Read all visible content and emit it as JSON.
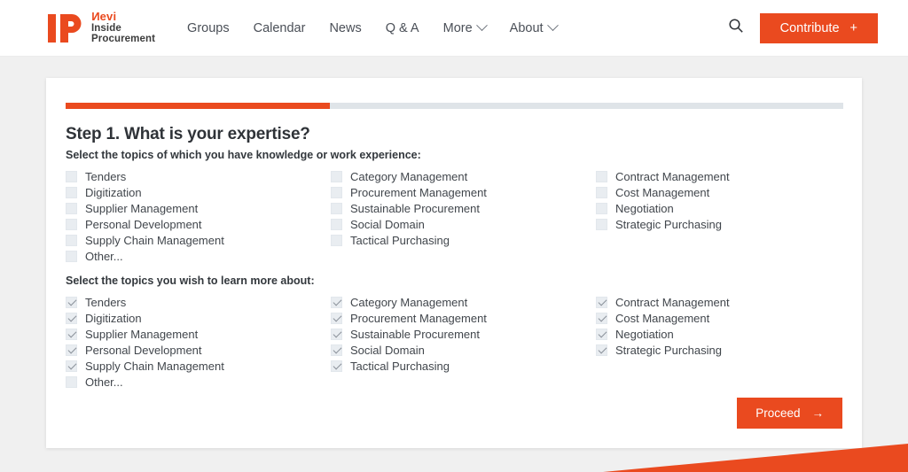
{
  "header": {
    "logo": {
      "mark_text": "IP",
      "brand": "Nevi",
      "line1": "Inside",
      "line2": "Procurement"
    },
    "nav": [
      {
        "label": "Groups",
        "has_chevron": false
      },
      {
        "label": "Calendar",
        "has_chevron": false
      },
      {
        "label": "News",
        "has_chevron": false
      },
      {
        "label": "Q & A",
        "has_chevron": false
      },
      {
        "label": "More",
        "has_chevron": true
      },
      {
        "label": "About",
        "has_chevron": true
      }
    ],
    "search_icon": "search-icon",
    "contribute_label": "Contribute",
    "contribute_plus": "+"
  },
  "card": {
    "progress": {
      "percent": 34,
      "value_label": "34%"
    },
    "step_title": "Step 1. What is your expertise?",
    "sections": [
      {
        "label": "Select the topics of which you have knowledge or work experience:",
        "columns": [
          [
            {
              "label": "Tenders",
              "checked": false
            },
            {
              "label": "Digitization",
              "checked": false
            },
            {
              "label": "Supplier Management",
              "checked": false
            },
            {
              "label": "Personal Development",
              "checked": false
            },
            {
              "label": "Supply Chain Management",
              "checked": false
            },
            {
              "label": "Other...",
              "checked": false
            }
          ],
          [
            {
              "label": "Category Management",
              "checked": false
            },
            {
              "label": "Procurement Management",
              "checked": false
            },
            {
              "label": "Sustainable Procurement",
              "checked": false
            },
            {
              "label": "Social Domain",
              "checked": false
            },
            {
              "label": "Tactical Purchasing",
              "checked": false
            }
          ],
          [
            {
              "label": "Contract Management",
              "checked": false
            },
            {
              "label": "Cost Management",
              "checked": false
            },
            {
              "label": "Negotiation",
              "checked": false
            },
            {
              "label": "Strategic Purchasing",
              "checked": false
            }
          ]
        ]
      },
      {
        "label": "Select the topics you wish to learn more about:",
        "columns": [
          [
            {
              "label": "Tenders",
              "checked": true
            },
            {
              "label": "Digitization",
              "checked": true
            },
            {
              "label": "Supplier Management",
              "checked": true
            },
            {
              "label": "Personal Development",
              "checked": true
            },
            {
              "label": "Supply Chain Management",
              "checked": true
            },
            {
              "label": "Other...",
              "checked": false
            }
          ],
          [
            {
              "label": "Category Management",
              "checked": true
            },
            {
              "label": "Procurement Management",
              "checked": true
            },
            {
              "label": "Sustainable Procurement",
              "checked": true
            },
            {
              "label": "Social Domain",
              "checked": true
            },
            {
              "label": "Tactical Purchasing",
              "checked": true
            }
          ],
          [
            {
              "label": "Contract Management",
              "checked": true
            },
            {
              "label": "Cost Management",
              "checked": true
            },
            {
              "label": "Negotiation",
              "checked": true
            },
            {
              "label": "Strategic Purchasing",
              "checked": true
            }
          ]
        ]
      }
    ],
    "proceed_label": "Proceed",
    "proceed_arrow": "→"
  },
  "colors": {
    "accent": "#ea4a1f",
    "page_bg": "#f0f0f0",
    "card_bg": "#ffffff",
    "text": "#41464c",
    "progress_track": "#dfe4e8",
    "checkbox_bg": "#e9edf1"
  }
}
